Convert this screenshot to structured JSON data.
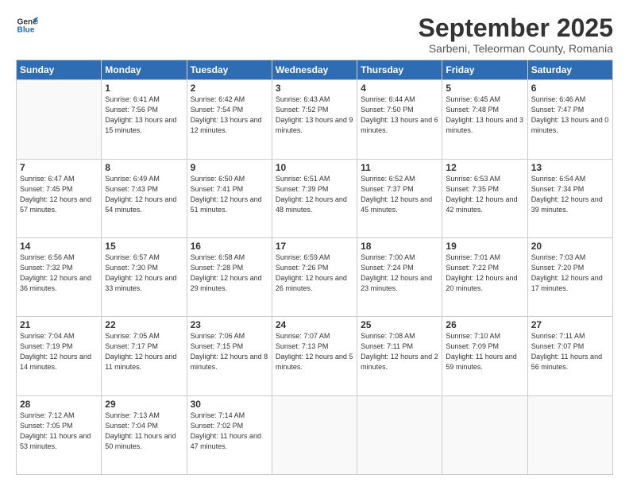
{
  "header": {
    "logo_line1": "General",
    "logo_line2": "Blue",
    "month": "September 2025",
    "location": "Sarbeni, Teleorman County, Romania"
  },
  "weekdays": [
    "Sunday",
    "Monday",
    "Tuesday",
    "Wednesday",
    "Thursday",
    "Friday",
    "Saturday"
  ],
  "weeks": [
    [
      {
        "day": "",
        "info": ""
      },
      {
        "day": "1",
        "info": "Sunrise: 6:41 AM\nSunset: 7:56 PM\nDaylight: 13 hours\nand 15 minutes."
      },
      {
        "day": "2",
        "info": "Sunrise: 6:42 AM\nSunset: 7:54 PM\nDaylight: 13 hours\nand 12 minutes."
      },
      {
        "day": "3",
        "info": "Sunrise: 6:43 AM\nSunset: 7:52 PM\nDaylight: 13 hours\nand 9 minutes."
      },
      {
        "day": "4",
        "info": "Sunrise: 6:44 AM\nSunset: 7:50 PM\nDaylight: 13 hours\nand 6 minutes."
      },
      {
        "day": "5",
        "info": "Sunrise: 6:45 AM\nSunset: 7:48 PM\nDaylight: 13 hours\nand 3 minutes."
      },
      {
        "day": "6",
        "info": "Sunrise: 6:46 AM\nSunset: 7:47 PM\nDaylight: 13 hours\nand 0 minutes."
      }
    ],
    [
      {
        "day": "7",
        "info": "Sunrise: 6:47 AM\nSunset: 7:45 PM\nDaylight: 12 hours\nand 57 minutes."
      },
      {
        "day": "8",
        "info": "Sunrise: 6:49 AM\nSunset: 7:43 PM\nDaylight: 12 hours\nand 54 minutes."
      },
      {
        "day": "9",
        "info": "Sunrise: 6:50 AM\nSunset: 7:41 PM\nDaylight: 12 hours\nand 51 minutes."
      },
      {
        "day": "10",
        "info": "Sunrise: 6:51 AM\nSunset: 7:39 PM\nDaylight: 12 hours\nand 48 minutes."
      },
      {
        "day": "11",
        "info": "Sunrise: 6:52 AM\nSunset: 7:37 PM\nDaylight: 12 hours\nand 45 minutes."
      },
      {
        "day": "12",
        "info": "Sunrise: 6:53 AM\nSunset: 7:35 PM\nDaylight: 12 hours\nand 42 minutes."
      },
      {
        "day": "13",
        "info": "Sunrise: 6:54 AM\nSunset: 7:34 PM\nDaylight: 12 hours\nand 39 minutes."
      }
    ],
    [
      {
        "day": "14",
        "info": "Sunrise: 6:56 AM\nSunset: 7:32 PM\nDaylight: 12 hours\nand 36 minutes."
      },
      {
        "day": "15",
        "info": "Sunrise: 6:57 AM\nSunset: 7:30 PM\nDaylight: 12 hours\nand 33 minutes."
      },
      {
        "day": "16",
        "info": "Sunrise: 6:58 AM\nSunset: 7:28 PM\nDaylight: 12 hours\nand 29 minutes."
      },
      {
        "day": "17",
        "info": "Sunrise: 6:59 AM\nSunset: 7:26 PM\nDaylight: 12 hours\nand 26 minutes."
      },
      {
        "day": "18",
        "info": "Sunrise: 7:00 AM\nSunset: 7:24 PM\nDaylight: 12 hours\nand 23 minutes."
      },
      {
        "day": "19",
        "info": "Sunrise: 7:01 AM\nSunset: 7:22 PM\nDaylight: 12 hours\nand 20 minutes."
      },
      {
        "day": "20",
        "info": "Sunrise: 7:03 AM\nSunset: 7:20 PM\nDaylight: 12 hours\nand 17 minutes."
      }
    ],
    [
      {
        "day": "21",
        "info": "Sunrise: 7:04 AM\nSunset: 7:19 PM\nDaylight: 12 hours\nand 14 minutes."
      },
      {
        "day": "22",
        "info": "Sunrise: 7:05 AM\nSunset: 7:17 PM\nDaylight: 12 hours\nand 11 minutes."
      },
      {
        "day": "23",
        "info": "Sunrise: 7:06 AM\nSunset: 7:15 PM\nDaylight: 12 hours\nand 8 minutes."
      },
      {
        "day": "24",
        "info": "Sunrise: 7:07 AM\nSunset: 7:13 PM\nDaylight: 12 hours\nand 5 minutes."
      },
      {
        "day": "25",
        "info": "Sunrise: 7:08 AM\nSunset: 7:11 PM\nDaylight: 12 hours\nand 2 minutes."
      },
      {
        "day": "26",
        "info": "Sunrise: 7:10 AM\nSunset: 7:09 PM\nDaylight: 11 hours\nand 59 minutes."
      },
      {
        "day": "27",
        "info": "Sunrise: 7:11 AM\nSunset: 7:07 PM\nDaylight: 11 hours\nand 56 minutes."
      }
    ],
    [
      {
        "day": "28",
        "info": "Sunrise: 7:12 AM\nSunset: 7:05 PM\nDaylight: 11 hours\nand 53 minutes."
      },
      {
        "day": "29",
        "info": "Sunrise: 7:13 AM\nSunset: 7:04 PM\nDaylight: 11 hours\nand 50 minutes."
      },
      {
        "day": "30",
        "info": "Sunrise: 7:14 AM\nSunset: 7:02 PM\nDaylight: 11 hours\nand 47 minutes."
      },
      {
        "day": "",
        "info": ""
      },
      {
        "day": "",
        "info": ""
      },
      {
        "day": "",
        "info": ""
      },
      {
        "day": "",
        "info": ""
      }
    ]
  ]
}
